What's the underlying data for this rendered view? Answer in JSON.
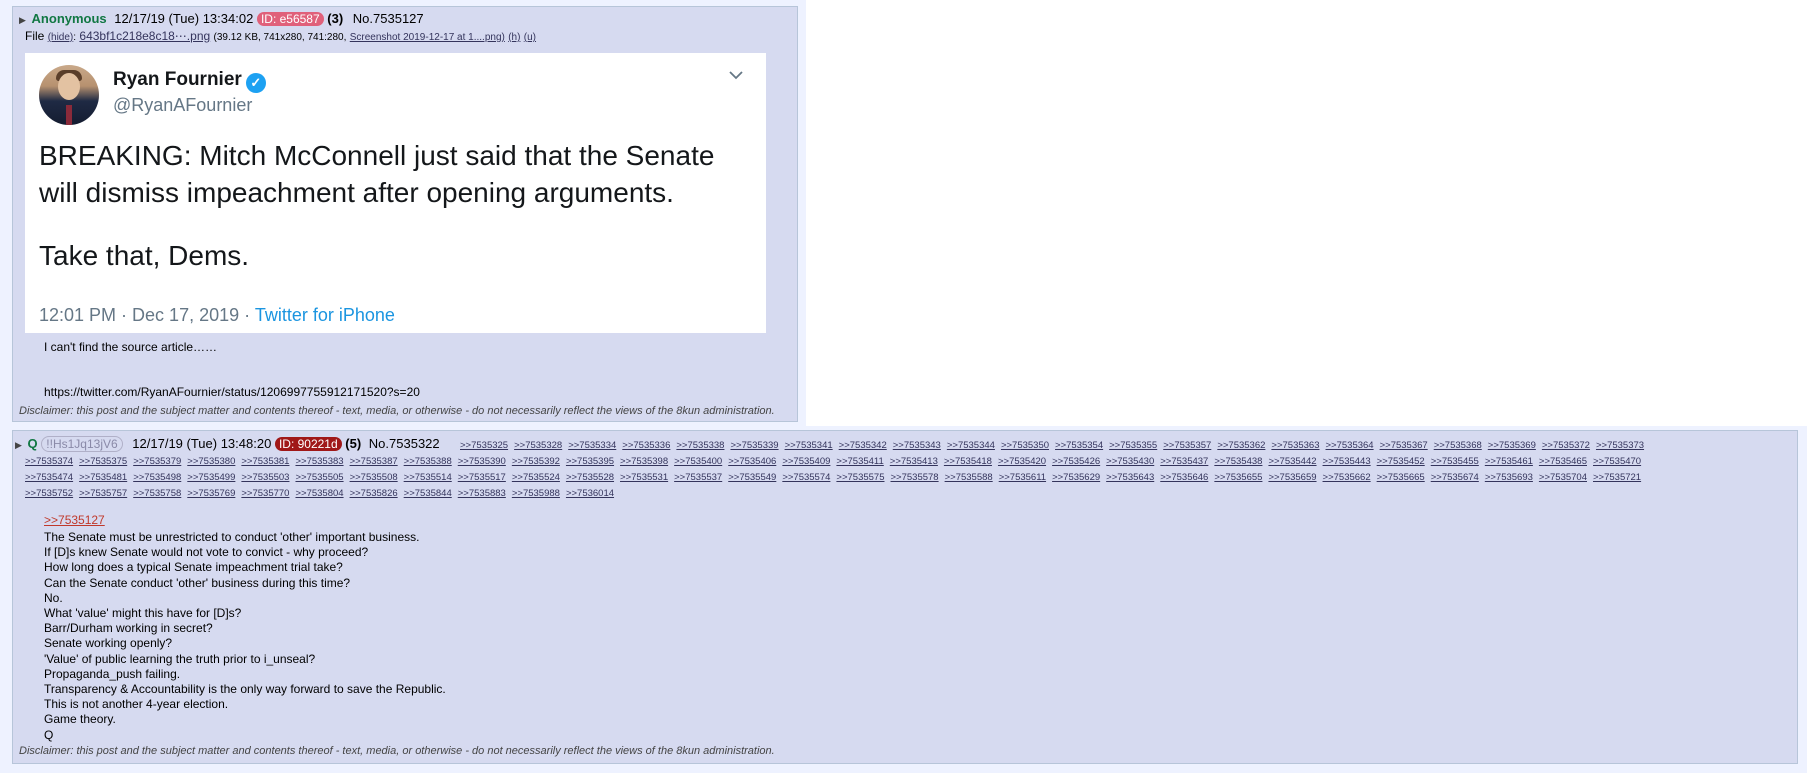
{
  "colors": {
    "post_bg": "#d6daf0",
    "name_green": "#117743",
    "id1_bg": "#e0607a",
    "id2_bg": "#a01818",
    "link": "#34345c",
    "quote_link": "#c0392b",
    "twitter_blue": "#1da1f2"
  },
  "post1": {
    "name": "Anonymous",
    "date": "12/17/19 (Tue) 13:34:02",
    "id": "ID: e56587",
    "count": "(3)",
    "number": "No.7535127",
    "file": {
      "label": "File",
      "hide": "(hide)",
      "filename": "643bf1c218e8c18⋯.png",
      "meta": "(39.12 KB, 741x280, 741:280,",
      "orig_name": "Screenshot 2019-12-17 at 1....png)",
      "h": "(h)",
      "u": "(u)"
    },
    "tweet": {
      "name": "Ryan Fournier",
      "handle": "@RyanAFournier",
      "line1": "BREAKING: Mitch McConnell just said that the Senate will dismiss impeachment after opening arguments.",
      "line2": "Take that, Dems.",
      "time": "12:01 PM · Dec 17, 2019 ·",
      "source": "Twitter for iPhone",
      "verified_icon": "verified-badge-icon",
      "menu_icon": "chevron-down-icon"
    },
    "body": {
      "line1": "I can't find the source article……",
      "line2": "https://twitter.com/RyanAFournier/status/1206997755912171520?s=20"
    },
    "disclaimer": "Disclaimer: this post and the subject matter and contents thereof - text, media, or otherwise - do not necessarily reflect the views of the 8kun administration."
  },
  "post2": {
    "name": "Q",
    "trip": "!!Hs1Jq13jV6",
    "date": "12/17/19 (Tue) 13:48:20",
    "id": "ID: 90221d",
    "count": "(5)",
    "number": "No.7535322",
    "backlinks_row1": [
      ">>7535325",
      ">>7535328",
      ">>7535334",
      ">>7535336",
      ">>7535338",
      ">>7535339",
      ">>7535341",
      ">>7535342",
      ">>7535343",
      ">>7535344",
      ">>7535350",
      ">>7535354",
      ">>7535355",
      ">>7535357",
      ">>7535362",
      ">>7535363",
      ">>7535364",
      ">>7535367",
      ">>7535368",
      ">>7535369",
      ">>7535372",
      ">>7535373"
    ],
    "backlinks_row2": [
      ">>7535374",
      ">>7535375",
      ">>7535379",
      ">>7535380",
      ">>7535381",
      ">>7535383",
      ">>7535387",
      ">>7535388",
      ">>7535390",
      ">>7535392",
      ">>7535395",
      ">>7535398",
      ">>7535400",
      ">>7535406",
      ">>7535409",
      ">>7535411",
      ">>7535413",
      ">>7535418",
      ">>7535420",
      ">>7535426",
      ">>7535430",
      ">>7535437",
      ">>7535438",
      ">>7535442",
      ">>7535443",
      ">>7535452",
      ">>7535455",
      ">>7535461",
      ">>7535465",
      ">>7535470"
    ],
    "backlinks_row3": [
      ">>7535474",
      ">>7535481",
      ">>7535498",
      ">>7535499",
      ">>7535503",
      ">>7535505",
      ">>7535508",
      ">>7535514",
      ">>7535517",
      ">>7535524",
      ">>7535528",
      ">>7535531",
      ">>7535537",
      ">>7535549",
      ">>7535574",
      ">>7535575",
      ">>7535578",
      ">>7535588",
      ">>7535611",
      ">>7535629",
      ">>7535643",
      ">>7535646",
      ">>7535655",
      ">>7535659",
      ">>7535662",
      ">>7535665",
      ">>7535674",
      ">>7535693",
      ">>7535704",
      ">>7535721"
    ],
    "backlinks_row4": [
      ">>7535752",
      ">>7535757",
      ">>7535758",
      ">>7535769",
      ">>7535770",
      ">>7535804",
      ">>7535826",
      ">>7535844",
      ">>7535883",
      ">>7535988",
      ">>7536014"
    ],
    "quote": ">>7535127",
    "lines": [
      "The Senate must be unrestricted to conduct 'other' important business.",
      "If [D]s knew Senate would not vote to convict - why proceed?",
      "How long does a typical Senate impeachment trial take?",
      "Can the Senate conduct 'other' business during this time?",
      "No.",
      "What 'value' might this have for [D]s?",
      "Barr/Durham working in secret?",
      "Senate working openly?",
      "'Value' of public learning the truth prior to i_unseal?",
      "Propaganda_push failing.",
      "Transparency & Accountability is the only way forward to save the Republic.",
      "This is not another 4-year election.",
      "Game theory.",
      "Q"
    ],
    "disclaimer": "Disclaimer: this post and the subject matter and contents thereof - text, media, or otherwise - do not necessarily reflect the views of the 8kun administration."
  }
}
